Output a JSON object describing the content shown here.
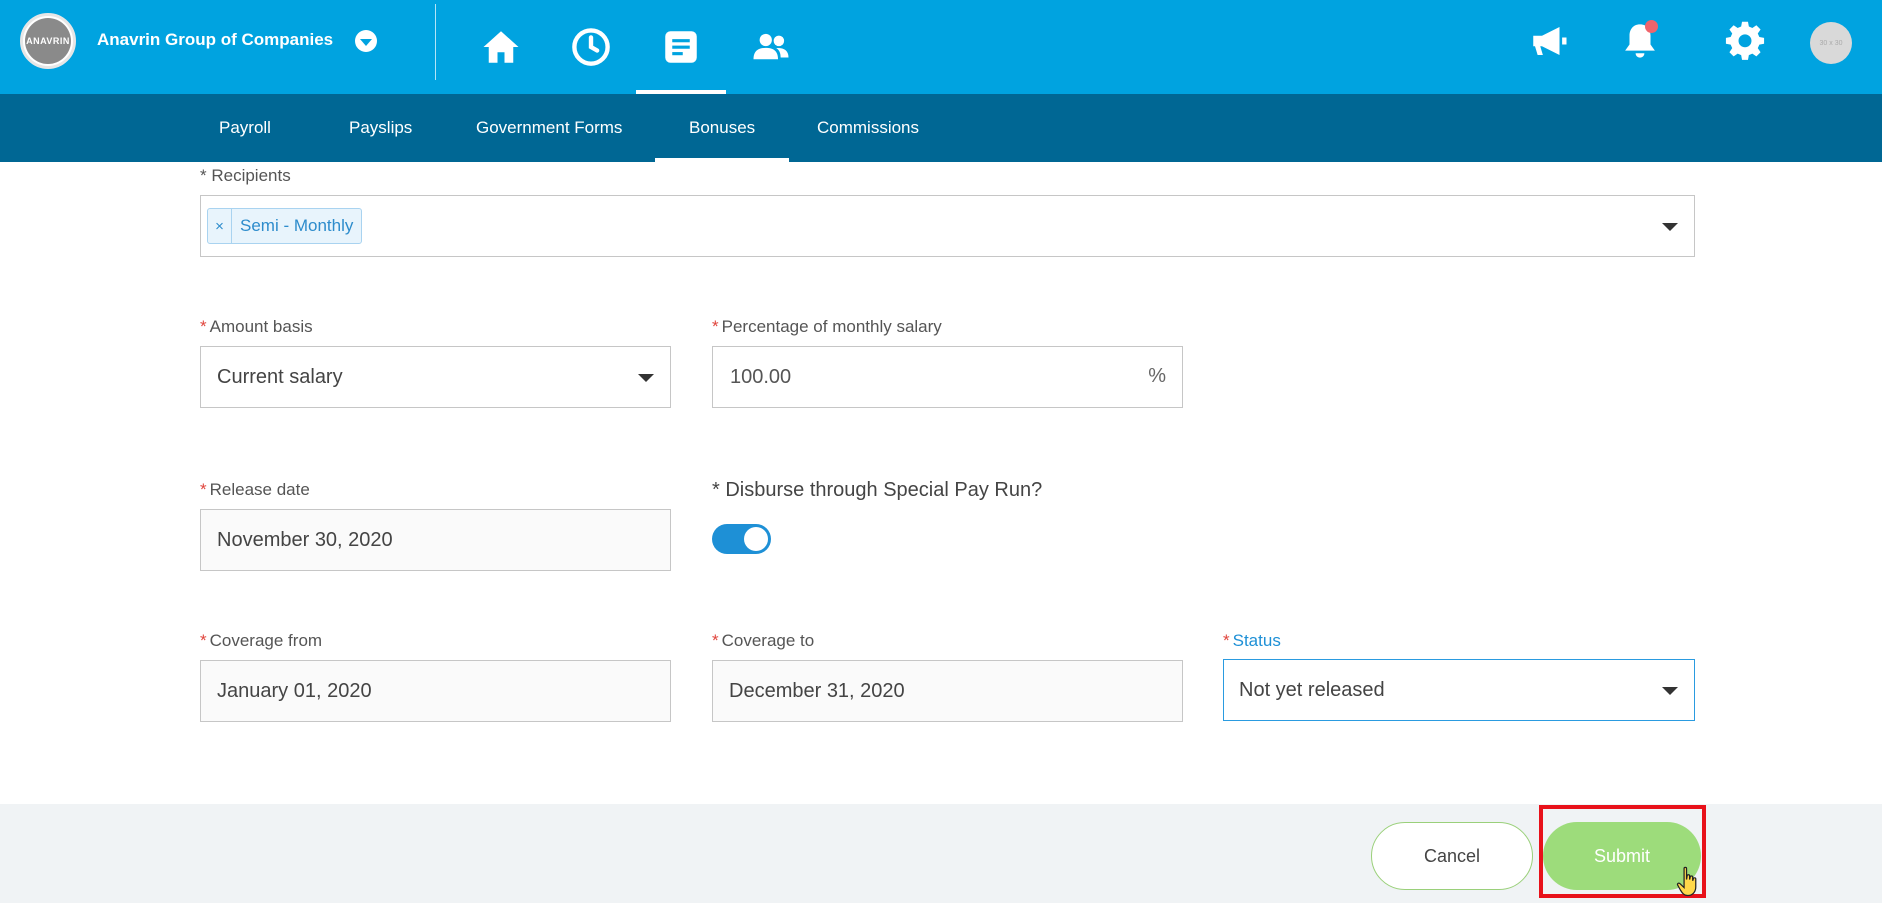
{
  "header": {
    "company_name": "Anavrin Group of Companies",
    "logo_text": "ANAVRIN",
    "avatar_text": "30 x 30",
    "nav_icons": [
      "home-icon",
      "clock-icon",
      "document-icon",
      "people-icon"
    ],
    "active_nav": "document-icon",
    "right_icons": [
      "megaphone-icon",
      "bell-icon",
      "gear-icon"
    ]
  },
  "subnav": {
    "tabs": [
      {
        "label": "Payroll"
      },
      {
        "label": "Payslips"
      },
      {
        "label": "Government Forms"
      },
      {
        "label": "Bonuses"
      },
      {
        "label": "Commissions"
      }
    ],
    "active": "Bonuses"
  },
  "form": {
    "recipients": {
      "label": "* Recipients",
      "tags": [
        "Semi - Monthly"
      ],
      "remove_symbol": "×"
    },
    "amount_basis": {
      "label": "Amount basis",
      "value": "Current salary"
    },
    "percentage": {
      "label": "Percentage of monthly salary",
      "value": "100.00",
      "unit": "%"
    },
    "release_date": {
      "label": "Release date",
      "value": "November 30, 2020"
    },
    "special_pay_run": {
      "label": "* Disburse through Special Pay Run?",
      "enabled": true
    },
    "coverage_from": {
      "label": "Coverage from",
      "value": "January 01, 2020"
    },
    "coverage_to": {
      "label": "Coverage to",
      "value": "December 31, 2020"
    },
    "status": {
      "label": "Status",
      "value": "Not yet released"
    },
    "required_marker": "*"
  },
  "footer": {
    "cancel_label": "Cancel",
    "submit_label": "Submit"
  },
  "colors": {
    "primary": "#00a3e0",
    "subnav": "#006794",
    "submit": "#9ddc7b",
    "highlight": "#e8111a"
  }
}
